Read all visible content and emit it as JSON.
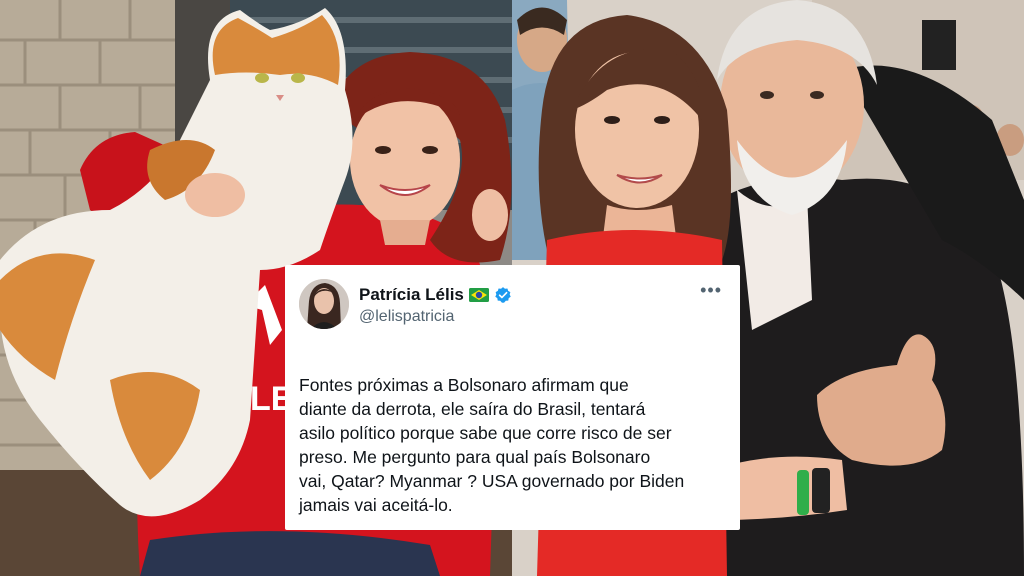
{
  "tweet": {
    "author_name": "Patrícia Lélis",
    "author_handle": "@lelispatricia",
    "flag_icon": "brazil-flag-icon",
    "verified_icon": "verified-badge-icon",
    "more_icon": "more-options-icon",
    "text": "Fontes próximas a Bolsonaro afirmam que\ndiante da derrota, ele saíra do Brasil, tentará\nasilo político porque sabe que corre risco de ser\npreso. Me pergunto para qual país Bolsonaro\nvai, Qatar? Myanmar ? USA governado por Biden\njamais vai aceitá-lo."
  },
  "photos": {
    "left": {
      "shirt_text": "LE"
    }
  },
  "colors": {
    "verified_blue": "#1d9bf0",
    "red_shirt": "#d4141e"
  }
}
